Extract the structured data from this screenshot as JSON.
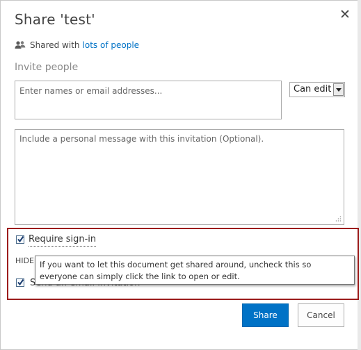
{
  "dialog": {
    "title": "Share 'test'",
    "close_icon": "close-icon"
  },
  "shared": {
    "prefix": "Shared with",
    "link": "lots of people",
    "icon": "people-icon"
  },
  "invite": {
    "label": "Invite people",
    "names_placeholder": "Enter names or email addresses...",
    "permission": "Can edit",
    "message_placeholder": "Include a personal message with this invitation (Optional)."
  },
  "options": {
    "require_signin": {
      "label": "Require sign-in",
      "checked": true
    },
    "hide_label": "HIDE",
    "send_email": {
      "label": "Send an email invitation",
      "checked": true
    },
    "tooltip": "If you want to let this document get shared around, uncheck this so everyone can simply click the link to open or edit."
  },
  "buttons": {
    "share": "Share",
    "cancel": "Cancel"
  },
  "colors": {
    "accent": "#0072c6",
    "highlight_border": "#9c1c1c"
  }
}
